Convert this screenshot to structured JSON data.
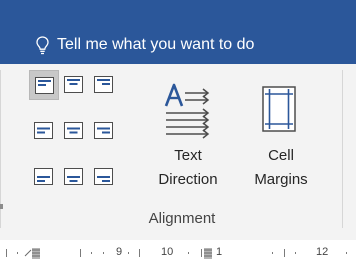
{
  "header": {
    "tell_me_text": "Tell me what you want to do",
    "lightbulb_icon": "lightbulb-icon"
  },
  "alignment": {
    "group_label": "Alignment",
    "cell_alignment_buttons": [
      {
        "name": "align-top-left",
        "selected": true
      },
      {
        "name": "align-top-center",
        "selected": false
      },
      {
        "name": "align-top-right",
        "selected": false
      },
      {
        "name": "align-center-left",
        "selected": false
      },
      {
        "name": "align-center-center",
        "selected": false
      },
      {
        "name": "align-center-right",
        "selected": false
      },
      {
        "name": "align-bottom-left",
        "selected": false
      },
      {
        "name": "align-bottom-center",
        "selected": false
      },
      {
        "name": "align-bottom-right",
        "selected": false
      }
    ],
    "text_direction": {
      "line1": "Text",
      "line2": "Direction",
      "icon": "text-direction-icon"
    },
    "cell_margins": {
      "line1": "Cell",
      "line2": "Margins",
      "icon": "cell-margins-icon"
    }
  },
  "ruler": {
    "labels": [
      "9",
      "10",
      "1",
      "12"
    ]
  },
  "colors": {
    "title_bar": "#2b579a",
    "ribbon": "#f3f3f3",
    "accent_blue": "#2b579a"
  }
}
